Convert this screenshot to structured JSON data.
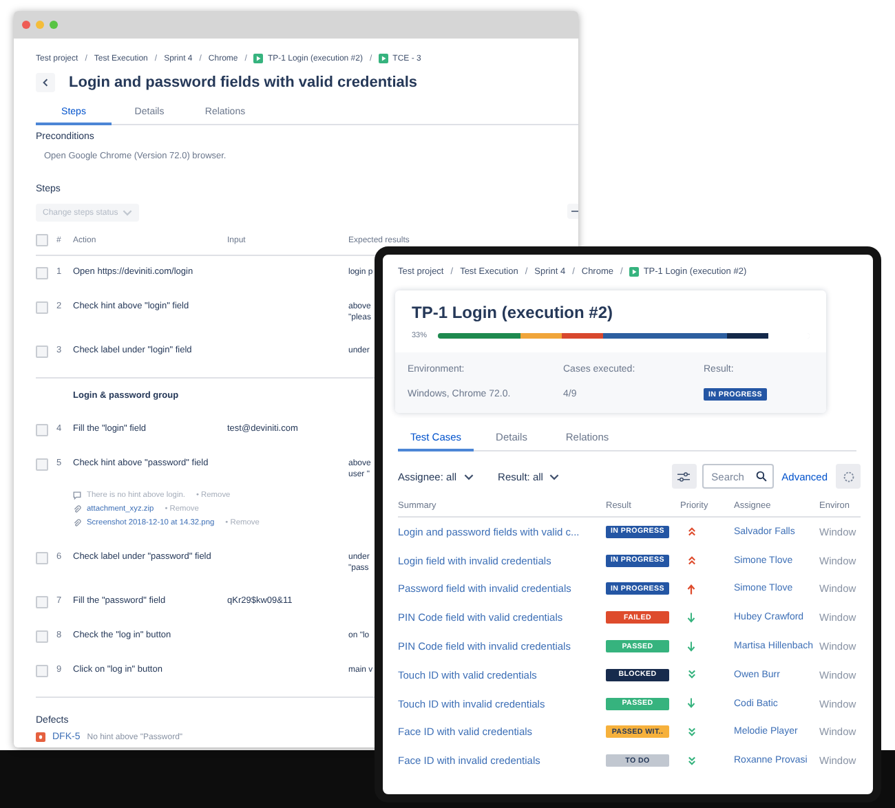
{
  "back_window": {
    "breadcrumb": [
      {
        "kind": "link",
        "label": "Test project"
      },
      {
        "kind": "sep",
        "label": "/"
      },
      {
        "kind": "link",
        "label": "Test Execution"
      },
      {
        "kind": "sep",
        "label": "/"
      },
      {
        "kind": "link",
        "label": "Sprint 4"
      },
      {
        "kind": "sep",
        "label": "/"
      },
      {
        "kind": "link",
        "label": "Chrome"
      },
      {
        "kind": "sep",
        "label": "/"
      },
      {
        "kind": "test",
        "label": "TP-1 Login (execution #2)"
      },
      {
        "kind": "sep",
        "label": "/"
      },
      {
        "kind": "test",
        "label": "TCE - 3"
      }
    ],
    "title": "Login and password fields with valid credentials",
    "tabs": [
      {
        "label": "Steps",
        "selected": true
      },
      {
        "label": "Details",
        "selected": false
      },
      {
        "label": "Relations",
        "selected": false
      }
    ],
    "preconditions": {
      "label": "Preconditions",
      "text": "Open Google Chrome (Version 72.0) browser."
    },
    "steps": {
      "label": "Steps",
      "status_dropdown": {
        "label": "Change steps status",
        "disabled": true
      },
      "select_all_checked": false,
      "columns": [
        "#",
        "Action",
        "Input",
        "Expected results"
      ],
      "rows": [
        {
          "kind": "step",
          "checked": false,
          "number": "1",
          "action": "Open https://deviniti.com/login",
          "expected": [
            "login p"
          ]
        },
        {
          "kind": "step",
          "checked": false,
          "number": "2",
          "action": "Check hint above \"login\" field",
          "expected": [
            "above",
            "\"pleas"
          ]
        },
        {
          "kind": "step",
          "checked": false,
          "number": "3",
          "action": "Check label under \"login\" field",
          "expected": [
            "under"
          ]
        },
        {
          "kind": "group",
          "label": "Login & password group"
        },
        {
          "kind": "step",
          "checked": false,
          "number": "4",
          "action": "Fill the \"login\" field",
          "input": "test@deviniti.com"
        },
        {
          "kind": "step",
          "checked": false,
          "number": "5",
          "action": "Check hint above \"password\" field",
          "expected": [
            "above",
            "user \""
          ],
          "notes": [
            {
              "kind": "comment",
              "text": "There is no hint above login.",
              "action": "• Remove"
            },
            {
              "kind": "attachment",
              "text": "attachment_xyz.zip",
              "action": "• Remove"
            },
            {
              "kind": "attachment",
              "text": "Screenshot 2018-12-10 at 14.32.png",
              "action": "• Remove"
            }
          ]
        },
        {
          "kind": "step",
          "checked": false,
          "number": "6",
          "action": "Check label under \"password\" field",
          "expected": [
            "under",
            "\"pass"
          ]
        },
        {
          "kind": "step",
          "checked": false,
          "number": "7",
          "action": "Fill the \"password\" field",
          "input": "qKr29$kw09&11"
        },
        {
          "kind": "step",
          "checked": false,
          "number": "8",
          "action": "Check the \"log in\" button",
          "expected": [
            "on \"lo"
          ]
        },
        {
          "kind": "step",
          "checked": false,
          "number": "9",
          "action": "Click on \"log in\" button",
          "expected": [
            "main v"
          ]
        }
      ]
    },
    "defects": {
      "label": "Defects",
      "items": [
        {
          "key": "DFK-5",
          "summary": "No hint above \"Password\""
        }
      ]
    }
  },
  "front_window": {
    "breadcrumb": [
      {
        "kind": "link",
        "label": "Test project"
      },
      {
        "kind": "sep",
        "label": "/"
      },
      {
        "kind": "link",
        "label": "Test Execution"
      },
      {
        "kind": "sep",
        "label": "/"
      },
      {
        "kind": "link",
        "label": "Sprint 4"
      },
      {
        "kind": "sep",
        "label": "/"
      },
      {
        "kind": "link",
        "label": "Chrome"
      },
      {
        "kind": "sep",
        "label": "/"
      },
      {
        "kind": "test",
        "label": "TP-1 Login (execution #2)"
      }
    ],
    "execution": {
      "title": "TP-1 Login (execution #2)",
      "percent": "33%",
      "segments": [
        {
          "color": "#1e8a4f"
        },
        {
          "color": "#1e8a4f"
        },
        {
          "color": "#f0a53a"
        },
        {
          "color": "#d8482e"
        },
        {
          "color": "#2d5fa0"
        },
        {
          "color": "#2d5fa0"
        },
        {
          "color": "#2d5fa0"
        },
        {
          "color": "#14294a"
        },
        {
          "color": "#ffffff"
        }
      ],
      "fields": [
        {
          "kind": "text",
          "label": "Environment:",
          "value": "Windows, Chrome 72.0."
        },
        {
          "kind": "text",
          "label": "Cases executed:",
          "value": "4/9"
        },
        {
          "kind": "badge",
          "label": "Result:",
          "value": "IN PROGRESS",
          "color": "#2456a4"
        }
      ]
    },
    "tabs": [
      {
        "label": "Test Cases",
        "selected": true
      },
      {
        "label": "Details",
        "selected": false
      },
      {
        "label": "Relations",
        "selected": false
      }
    ],
    "filters": [
      {
        "label": "Assignee: all"
      },
      {
        "label": "Result: all"
      }
    ],
    "search": {
      "placeholder": "Search"
    },
    "advanced_link": "Advanced",
    "table": {
      "columns": [
        "Summary",
        "Result",
        "Priority",
        "Assignee",
        "Environ"
      ],
      "rows": [
        {
          "summary": "Login and password fields with valid c...",
          "result": "IN PROGRESS",
          "color": "#2456a4",
          "priority": {
            "kind": "highest"
          },
          "assignee": "Salvador Falls",
          "environment": "Window"
        },
        {
          "summary": "Login field with invalid credentials",
          "result": "IN PROGRESS",
          "color": "#2456a4",
          "priority": {
            "kind": "highest"
          },
          "assignee": "Simone Tlove",
          "environment": "Window"
        },
        {
          "summary": "Password field with invalid credentials",
          "result": "IN PROGRESS",
          "color": "#2456a4",
          "priority": {
            "kind": "high"
          },
          "assignee": "Simone Tlove",
          "environment": "Window"
        },
        {
          "summary": "PIN Code field with valid credentials",
          "result": "FAILED",
          "color": "#de4b2c",
          "priority": {
            "kind": "low"
          },
          "assignee": "Hubey Crawford",
          "environment": "Window"
        },
        {
          "summary": "PIN Code field with invalid credentials",
          "result": "PASSED",
          "color": "#36b37e",
          "priority": {
            "kind": "low"
          },
          "assignee": "Martisa Hillenbach",
          "environment": "Window"
        },
        {
          "summary": "Touch ID with valid credentials",
          "result": "BLOCKED",
          "color": "#172b4d",
          "priority": {
            "kind": "lowest"
          },
          "assignee": "Owen Burr",
          "environment": "Window"
        },
        {
          "summary": "Touch ID with invalid credentials",
          "result": "PASSED",
          "color": "#36b37e",
          "priority": {
            "kind": "low"
          },
          "assignee": "Codi Batic",
          "environment": "Window"
        },
        {
          "summary": "Face ID with valid credentials",
          "result": "PASSED WIT..",
          "color": "#f6b13c",
          "priority": {
            "kind": "lowest"
          },
          "assignee": "Melodie Player",
          "environment": "Window"
        },
        {
          "summary": "Face ID with invalid credentials",
          "result": "TO DO",
          "color": "#c1c7d0",
          "priority": {
            "kind": "lowest"
          },
          "assignee": "Roxanne Provasi",
          "environment": "Window"
        }
      ]
    }
  }
}
